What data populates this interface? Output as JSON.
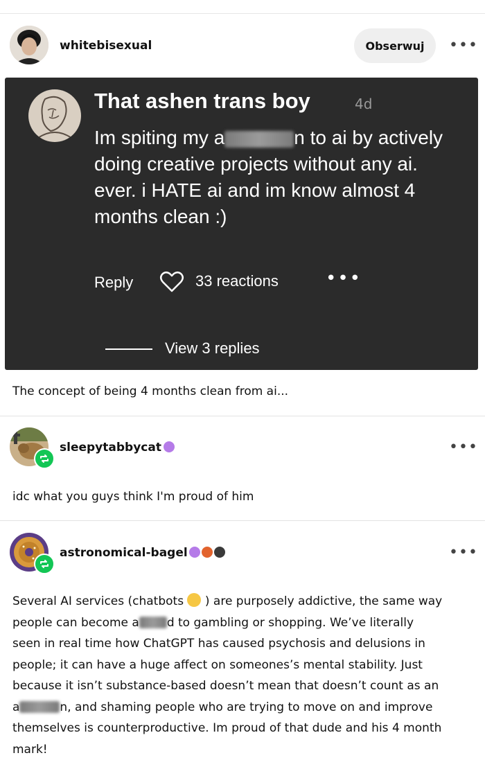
{
  "post": {
    "username": "whitebisexual",
    "follow_label": "Obserwuj",
    "more_label": "•••",
    "caption": "The concept of being 4 months clean from ai..."
  },
  "screenshot_card": {
    "name": "That ashen trans boy",
    "age": "4d",
    "text_part1": "Im spiting my a",
    "text_part2": "n to ai by actively doing creative projects without any ai. ever. i HATE ai and im know almost 4 months clean :)",
    "reply_label": "Reply",
    "reactions": "33 reactions",
    "dots": "•••",
    "view_replies": "View 3 replies"
  },
  "reblogs": [
    {
      "username": "sleepytabbycat",
      "text": "idc what you guys think I'm proud of him"
    },
    {
      "username": "astronomical-bagel",
      "text_lines": [
        "Several AI services (chatbots",
        ") are purposely addictive, the same way",
        "people can become a",
        "d to gambling or shopping. We’ve literally",
        "seen in real time how ChatGPT has caused psychosis and delusions in",
        "people; it can have a huge affect on someones’s mental stability. Just",
        "because it isn’t substance-based doesn’t mean that doesn’t count as an",
        "a",
        "n, and shaming people who are trying to move on and improve",
        "themselves is counterproductive. Im proud of that dude and his 4 month",
        "mark!"
      ]
    }
  ],
  "colors": {
    "card_bg": "#2b2b2b",
    "reblog_green": "#13c655",
    "badge_purple": "#b57be8"
  }
}
